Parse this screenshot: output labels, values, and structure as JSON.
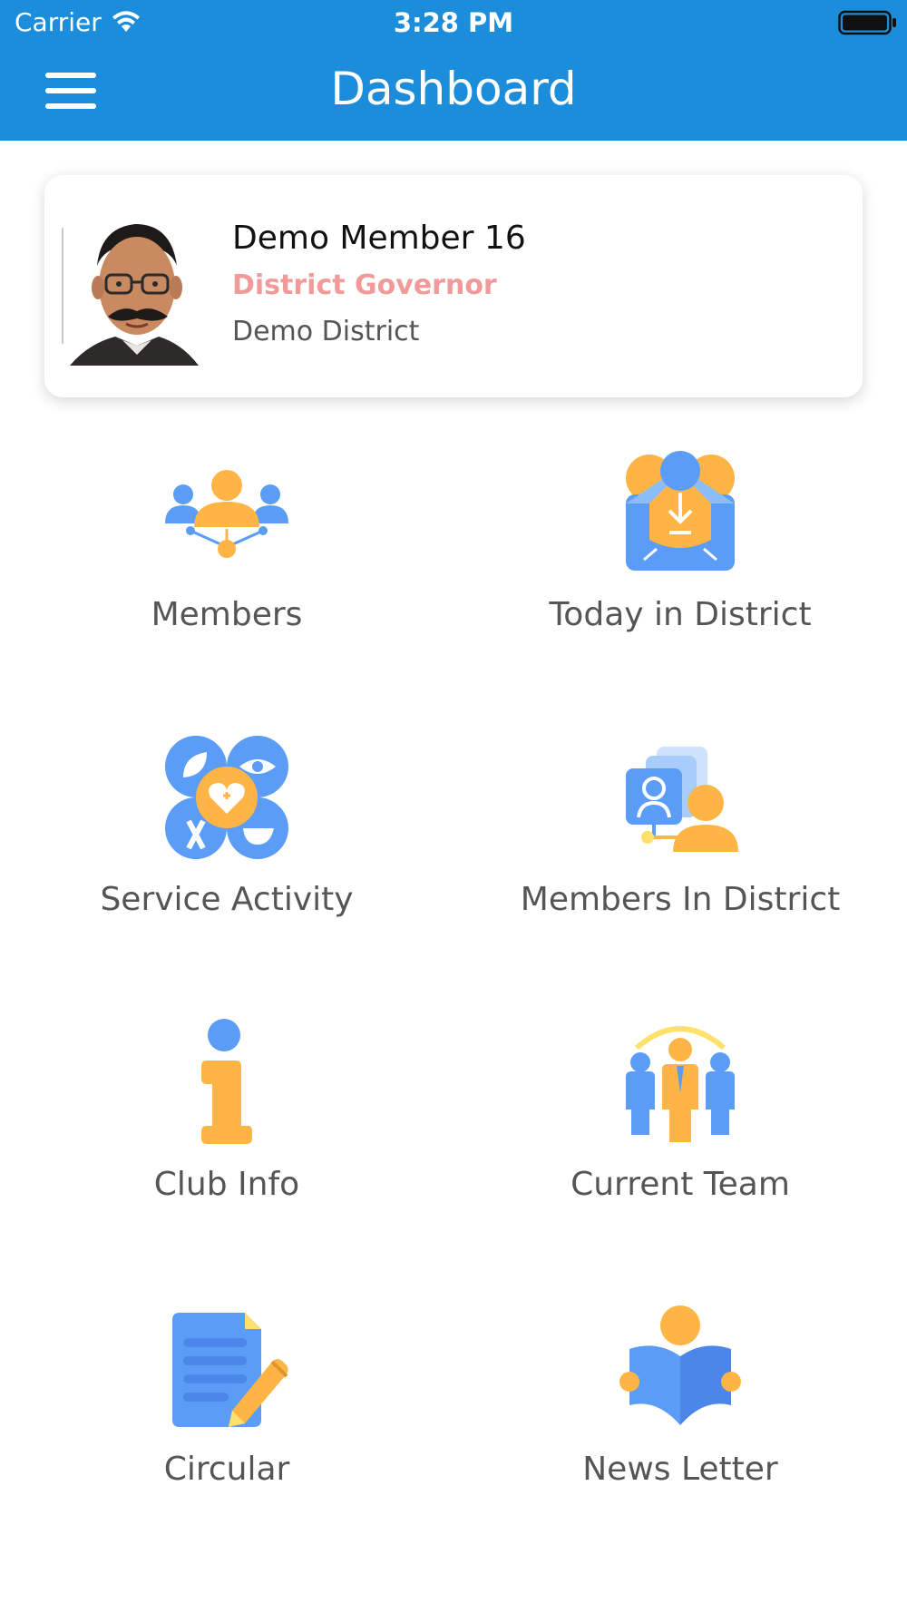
{
  "status_bar": {
    "carrier": "Carrier",
    "time": "3:28 PM"
  },
  "header": {
    "title": "Dashboard"
  },
  "profile": {
    "name": "Demo Member 16",
    "role": "District Governor",
    "district": "Demo District"
  },
  "tiles": [
    {
      "label": "Members",
      "icon": "members-network-icon"
    },
    {
      "label": "Today in District",
      "icon": "mail-inbox-icon"
    },
    {
      "label": "Service Activity",
      "icon": "service-activity-icon"
    },
    {
      "label": "Members In  District",
      "icon": "member-profiles-icon"
    },
    {
      "label": "Club Info",
      "icon": "info-icon"
    },
    {
      "label": "Current Team",
      "icon": "team-icon"
    },
    {
      "label": "Circular",
      "icon": "document-pencil-icon"
    },
    {
      "label": "News Letter",
      "icon": "reading-book-icon"
    }
  ],
  "colors": {
    "header_blue": "#1c8ddb",
    "icon_blue": "#5b9cf6",
    "icon_orange": "#ffb545",
    "role_pink": "#f29a9a"
  }
}
